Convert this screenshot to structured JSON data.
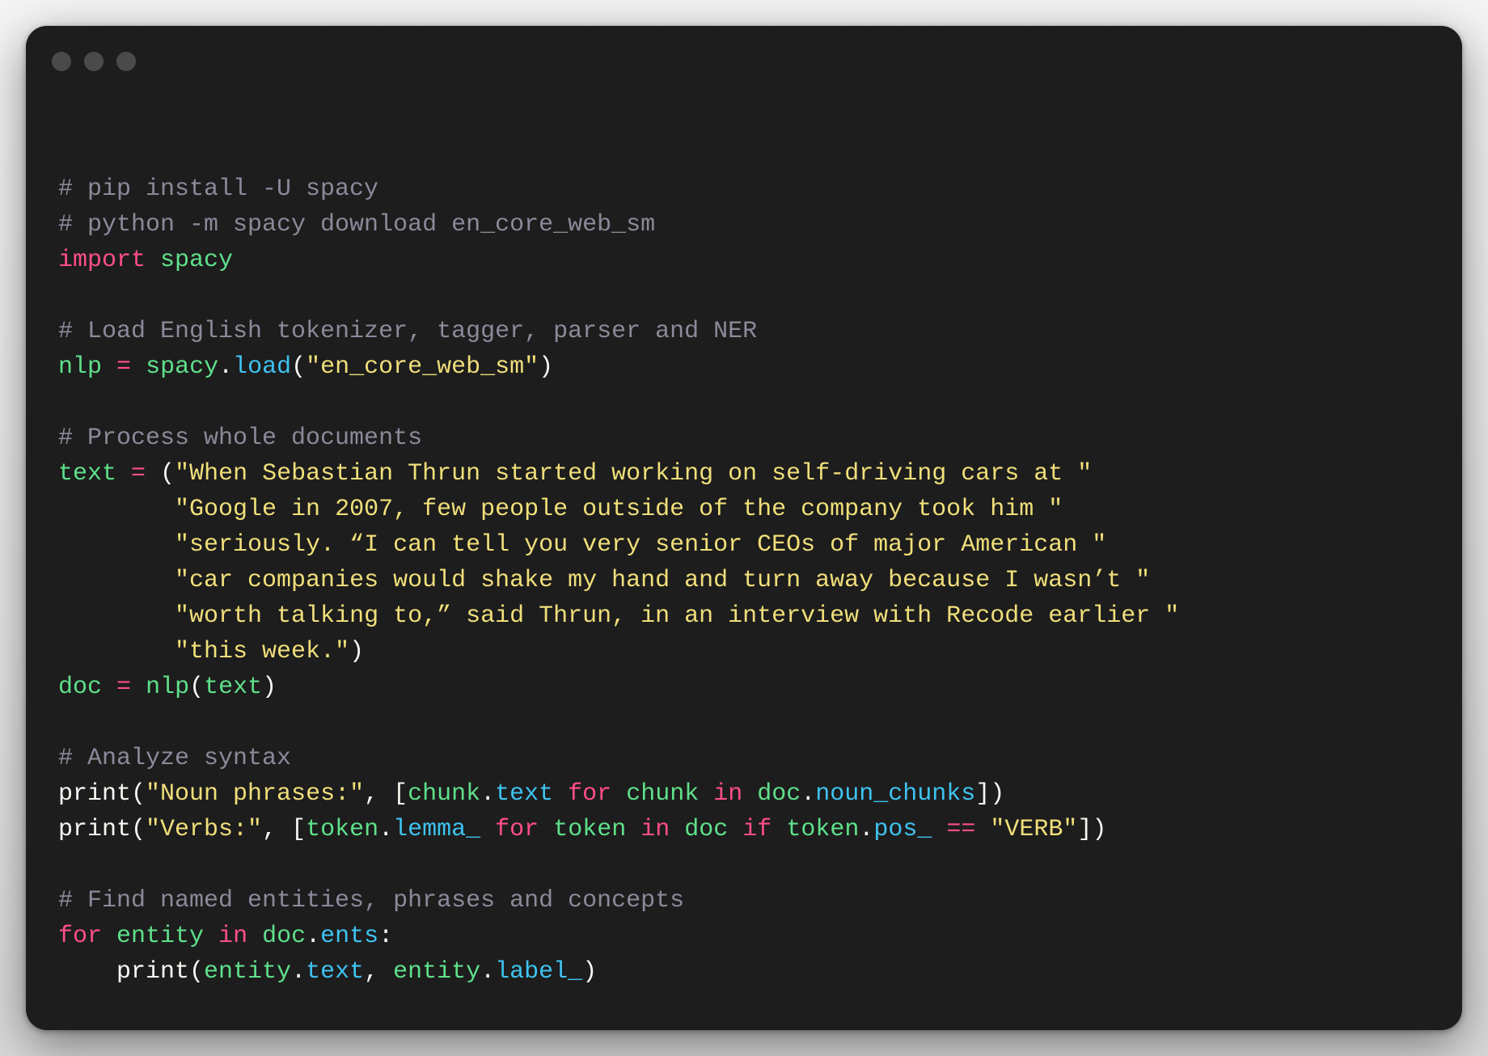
{
  "colors": {
    "background": "#1d1d1d",
    "comment": "#8a8a9a",
    "keyword": "#ff4f86",
    "name": "#5fe08a",
    "string": "#f0df7a",
    "method": "#3ec3f0",
    "plain": "#f8f8f2"
  },
  "window": {
    "controls": [
      "close-dot",
      "minimize-dot",
      "zoom-dot"
    ]
  },
  "code": {
    "lines": [
      [
        [
          "c",
          "# pip install -U spacy"
        ]
      ],
      [
        [
          "c",
          "# python -m spacy download en_core_web_sm"
        ]
      ],
      [
        [
          "k",
          "import"
        ],
        [
          "p",
          " "
        ],
        [
          "n",
          "spacy"
        ]
      ],
      [],
      [
        [
          "c",
          "# Load English tokenizer, tagger, parser and NER"
        ]
      ],
      [
        [
          "n",
          "nlp"
        ],
        [
          "p",
          " "
        ],
        [
          "k",
          "="
        ],
        [
          "p",
          " "
        ],
        [
          "n",
          "spacy"
        ],
        [
          "p",
          "."
        ],
        [
          "m",
          "load"
        ],
        [
          "p",
          "("
        ],
        [
          "s",
          "\"en_core_web_sm\""
        ],
        [
          "p",
          ")"
        ]
      ],
      [],
      [
        [
          "c",
          "# Process whole documents"
        ]
      ],
      [
        [
          "n",
          "text"
        ],
        [
          "p",
          " "
        ],
        [
          "k",
          "="
        ],
        [
          "p",
          " ("
        ],
        [
          "s",
          "\"When Sebastian Thrun started working on self-driving cars at \""
        ]
      ],
      [
        [
          "p",
          "        "
        ],
        [
          "s",
          "\"Google in 2007, few people outside of the company took him \""
        ]
      ],
      [
        [
          "p",
          "        "
        ],
        [
          "s",
          "\"seriously. “I can tell you very senior CEOs of major American \""
        ]
      ],
      [
        [
          "p",
          "        "
        ],
        [
          "s",
          "\"car companies would shake my hand and turn away because I wasn’t \""
        ]
      ],
      [
        [
          "p",
          "        "
        ],
        [
          "s",
          "\"worth talking to,” said Thrun, in an interview with Recode earlier \""
        ]
      ],
      [
        [
          "p",
          "        "
        ],
        [
          "s",
          "\"this week.\""
        ],
        [
          "p",
          ")"
        ]
      ],
      [
        [
          "n",
          "doc"
        ],
        [
          "p",
          " "
        ],
        [
          "k",
          "="
        ],
        [
          "p",
          " "
        ],
        [
          "n",
          "nlp"
        ],
        [
          "p",
          "("
        ],
        [
          "n",
          "text"
        ],
        [
          "p",
          ")"
        ]
      ],
      [],
      [
        [
          "c",
          "# Analyze syntax"
        ]
      ],
      [
        [
          "p",
          "print("
        ],
        [
          "s",
          "\"Noun phrases:\""
        ],
        [
          "p",
          ", ["
        ],
        [
          "n",
          "chunk"
        ],
        [
          "p",
          "."
        ],
        [
          "m",
          "text"
        ],
        [
          "p",
          " "
        ],
        [
          "k",
          "for"
        ],
        [
          "p",
          " "
        ],
        [
          "n",
          "chunk"
        ],
        [
          "p",
          " "
        ],
        [
          "k",
          "in"
        ],
        [
          "p",
          " "
        ],
        [
          "n",
          "doc"
        ],
        [
          "p",
          "."
        ],
        [
          "m",
          "noun_chunks"
        ],
        [
          "p",
          "])"
        ]
      ],
      [
        [
          "p",
          "print("
        ],
        [
          "s",
          "\"Verbs:\""
        ],
        [
          "p",
          ", ["
        ],
        [
          "n",
          "token"
        ],
        [
          "p",
          "."
        ],
        [
          "m",
          "lemma_"
        ],
        [
          "p",
          " "
        ],
        [
          "k",
          "for"
        ],
        [
          "p",
          " "
        ],
        [
          "n",
          "token"
        ],
        [
          "p",
          " "
        ],
        [
          "k",
          "in"
        ],
        [
          "p",
          " "
        ],
        [
          "n",
          "doc"
        ],
        [
          "p",
          " "
        ],
        [
          "k",
          "if"
        ],
        [
          "p",
          " "
        ],
        [
          "n",
          "token"
        ],
        [
          "p",
          "."
        ],
        [
          "m",
          "pos_"
        ],
        [
          "p",
          " "
        ],
        [
          "k",
          "=="
        ],
        [
          "p",
          " "
        ],
        [
          "s",
          "\"VERB\""
        ],
        [
          "p",
          "])"
        ]
      ],
      [],
      [
        [
          "c",
          "# Find named entities, phrases and concepts"
        ]
      ],
      [
        [
          "k",
          "for"
        ],
        [
          "p",
          " "
        ],
        [
          "n",
          "entity"
        ],
        [
          "p",
          " "
        ],
        [
          "k",
          "in"
        ],
        [
          "p",
          " "
        ],
        [
          "n",
          "doc"
        ],
        [
          "p",
          "."
        ],
        [
          "m",
          "ents"
        ],
        [
          "p",
          ":"
        ]
      ],
      [
        [
          "p",
          "    print("
        ],
        [
          "n",
          "entity"
        ],
        [
          "p",
          "."
        ],
        [
          "m",
          "text"
        ],
        [
          "p",
          ", "
        ],
        [
          "n",
          "entity"
        ],
        [
          "p",
          "."
        ],
        [
          "m",
          "label_"
        ],
        [
          "p",
          ")"
        ]
      ]
    ]
  }
}
